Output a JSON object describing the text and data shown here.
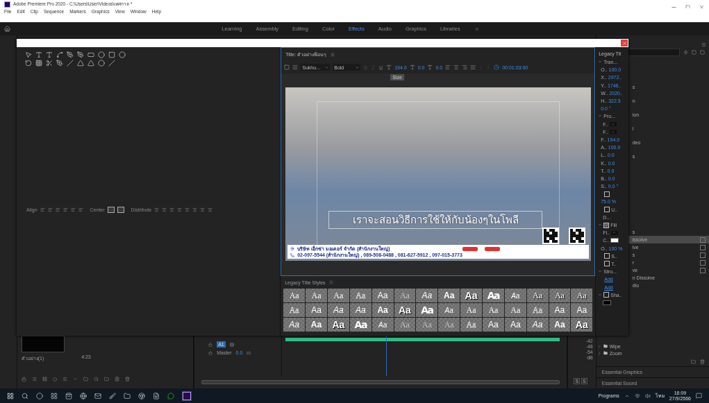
{
  "window": {
    "title": "Adobe Premiere Pro 2020 - C:\\Users\\User\\Videos\\เทศกาล *"
  },
  "menu": [
    "File",
    "Edit",
    "Clip",
    "Sequence",
    "Markers",
    "Graphics",
    "View",
    "Window",
    "Help"
  ],
  "workspaces": [
    {
      "label": "Learning",
      "selected": false
    },
    {
      "label": "Assembly",
      "selected": false
    },
    {
      "label": "Editing",
      "selected": false
    },
    {
      "label": "Color",
      "selected": false
    },
    {
      "label": "Effects",
      "selected": true
    },
    {
      "label": "Audio",
      "selected": false
    },
    {
      "label": "Graphics",
      "selected": false
    },
    {
      "label": "Libraries",
      "selected": false
    }
  ],
  "tools_panel": {
    "align_labels": [
      "Align",
      "Center",
      "Distribute"
    ]
  },
  "title_panel": {
    "title": "Title: ตัวอย่างฟ้อนๆ",
    "font": "Sukhu...",
    "style": "Bold",
    "size": "194.0",
    "kerning": "0.0",
    "leading": "0.0",
    "timecode": "00:01:03:00",
    "tooltip": "Size",
    "caption": "เราจะสอนวิธีการใช้ให้กับน้องๆในโพลี",
    "banner": [
      "บริษัท เอ็กซ่า มอเตอร์ จำกัด (สำนักงานใหญ่)",
      "02-097-5544 (สำนักงานใหญ่) , 089-508-0488 , 081-627-5912 , 097-015-3773"
    ]
  },
  "styles_panel": {
    "title": "Legacy Title Styles",
    "rows": [
      [
        {
          "label": "Aa",
          "kind": "serif"
        },
        {
          "label": "Aa",
          "kind": "serif"
        },
        {
          "label": "Aa",
          "kind": "serif"
        },
        {
          "label": "Aa",
          "kind": "outline"
        },
        {
          "label": "Aa",
          "kind": "sans"
        },
        {
          "label": "Aa",
          "kind": "light"
        },
        {
          "label": "Aa",
          "kind": "italic"
        },
        {
          "label": "Aa",
          "kind": "bold"
        },
        {
          "label": "Aa",
          "kind": "heavy"
        },
        {
          "label": "Aa",
          "kind": "condensed"
        },
        {
          "label": "Aa",
          "kind": "small"
        },
        {
          "label": "Aa",
          "kind": "shadow"
        },
        {
          "label": "Aa",
          "kind": "shadow"
        },
        {
          "label": "Aa",
          "kind": "shadow"
        }
      ],
      [
        {
          "label": "Aa",
          "kind": "outline"
        },
        {
          "label": "Aa",
          "kind": "sans"
        },
        {
          "label": "Aa",
          "kind": "italic"
        },
        {
          "label": "Aa",
          "kind": "italic"
        },
        {
          "label": "Aa",
          "kind": "bold"
        },
        {
          "label": "Aa",
          "kind": "heavy"
        },
        {
          "label": "Aa",
          "kind": "condensed"
        },
        {
          "label": "Aa",
          "kind": "small"
        },
        {
          "label": "Aa",
          "kind": "serif"
        },
        {
          "label": "Aa",
          "kind": "serif"
        },
        {
          "label": "Aa",
          "kind": "serif"
        },
        {
          "label": "Aa",
          "kind": "outline"
        },
        {
          "label": "Aa",
          "kind": "sans"
        },
        {
          "label": "Aa",
          "kind": "sans"
        }
      ],
      [
        {
          "label": "Aa",
          "kind": "italic"
        },
        {
          "label": "Aa",
          "kind": "bold"
        },
        {
          "label": "Aa",
          "kind": "heavy"
        },
        {
          "label": "Aa",
          "kind": "condensed"
        },
        {
          "label": "Aa",
          "kind": "small"
        },
        {
          "label": "Aa",
          "kind": "light"
        },
        {
          "label": "Aa",
          "kind": "light"
        },
        {
          "label": "Aa",
          "kind": "light"
        },
        {
          "label": "Aa",
          "kind": "outline"
        },
        {
          "label": "Aa",
          "kind": "sans"
        },
        {
          "label": "Aa",
          "kind": "sans"
        },
        {
          "label": "Aa",
          "kind": "italic"
        },
        {
          "label": "Aa",
          "kind": "bold"
        },
        {
          "label": "Aa",
          "kind": "heavy"
        }
      ]
    ]
  },
  "properties_panel": {
    "title": "Legacy Tit",
    "items": [
      {
        "kind": "group",
        "label": "Tran...",
        "expanded": true
      },
      {
        "kind": "value",
        "label": "O..",
        "value": "100.0"
      },
      {
        "kind": "value",
        "label": "X..",
        "value": "2972.."
      },
      {
        "kind": "value",
        "label": "Y..",
        "value": "1746.."
      },
      {
        "kind": "value",
        "label": "W..",
        "value": "2020.."
      },
      {
        "kind": "value",
        "label": "H..",
        "value": "322.5"
      },
      {
        "kind": "value",
        "value": "0.0 °"
      },
      {
        "kind": "group",
        "label": "Pro...",
        "expanded": true
      },
      {
        "kind": "dropdown",
        "label": "F.."
      },
      {
        "kind": "dropdown",
        "label": "F.."
      },
      {
        "kind": "value",
        "label": "F..",
        "value": "194.0"
      },
      {
        "kind": "value",
        "label": "A..",
        "value": "100.0"
      },
      {
        "kind": "value",
        "label": "L..",
        "value": "0.0"
      },
      {
        "kind": "value",
        "label": "K..",
        "value": "0.0"
      },
      {
        "kind": "value",
        "label": "T..",
        "value": "0.0"
      },
      {
        "kind": "value",
        "label": "B..",
        "value": "0.0"
      },
      {
        "kind": "value",
        "label": "S..",
        "value": "0.0 °"
      },
      {
        "kind": "checkbox",
        "checked": false
      },
      {
        "kind": "value",
        "value": "75.0 %"
      },
      {
        "kind": "checkbox",
        "label": "U..",
        "checked": false
      },
      {
        "kind": "text",
        "label": "D..."
      },
      {
        "kind": "checkgroup",
        "label": "Fill",
        "checked": true,
        "expanded": true
      },
      {
        "kind": "dropdown",
        "label": "Fi.."
      },
      {
        "kind": "swatch",
        "label": "C..",
        "color": "#ffffff"
      },
      {
        "kind": "value",
        "label": "O..",
        "value": "100 %"
      },
      {
        "kind": "checkbox",
        "label": "S..",
        "checked": false
      },
      {
        "kind": "checkbox",
        "label": "T..",
        "checked": false
      },
      {
        "kind": "group",
        "label": "Stro...",
        "expanded": true
      },
      {
        "kind": "link",
        "label": "Add"
      },
      {
        "kind": "link",
        "label": "Add"
      },
      {
        "kind": "checkgroup",
        "label": "Sha..",
        "checked": false,
        "expanded": true
      },
      {
        "kind": "swatch",
        "color": "#000000"
      }
    ]
  },
  "project_panel": {
    "clip_name": "ตัวอย่าง(1)",
    "duration": "4:23"
  },
  "timeline": {
    "tracks": [
      {
        "name": "A1",
        "selected": true
      }
    ],
    "master": {
      "label": "Master",
      "value": "0.0"
    }
  },
  "meter": {
    "labels": [
      "-42",
      "-48",
      "-54",
      "dB"
    ],
    "solo": [
      "S",
      "S"
    ]
  },
  "effects_panel": {
    "groups": [
      [
        {
          "label": "s",
          "selected": false,
          "accelerated": false
        },
        {
          "label": "n",
          "selected": false,
          "accelerated": false
        },
        {
          "label": "ion",
          "selected": false,
          "accelerated": false
        },
        {
          "label": "l",
          "selected": false,
          "accelerated": false
        },
        {
          "label": "deo",
          "selected": false,
          "accelerated": false
        },
        {
          "label": "s",
          "selected": false,
          "accelerated": false
        }
      ],
      [
        {
          "label": "s",
          "selected": false,
          "accelerated": false
        },
        {
          "label": "issolve",
          "selected": true,
          "accelerated": true
        },
        {
          "label": "ive",
          "selected": false,
          "accelerated": true
        },
        {
          "label": "s",
          "selected": false,
          "accelerated": true
        },
        {
          "label": "r",
          "selected": false,
          "accelerated": true
        },
        {
          "label": "ve",
          "selected": false,
          "accelerated": true
        },
        {
          "label": "n Dissolve",
          "selected": false,
          "accelerated": false
        },
        {
          "label": "dio",
          "selected": false,
          "accelerated": false
        }
      ]
    ],
    "folders": [
      {
        "label": "Wipe",
        "expanded": false
      },
      {
        "label": "Zoom",
        "expanded": false
      }
    ],
    "sections": [
      "Essential Graphics",
      "Essential Sound"
    ]
  },
  "taskbar": {
    "label": "Programs",
    "language": "ไทย",
    "time": "16:09",
    "date": "27/9/2566"
  }
}
